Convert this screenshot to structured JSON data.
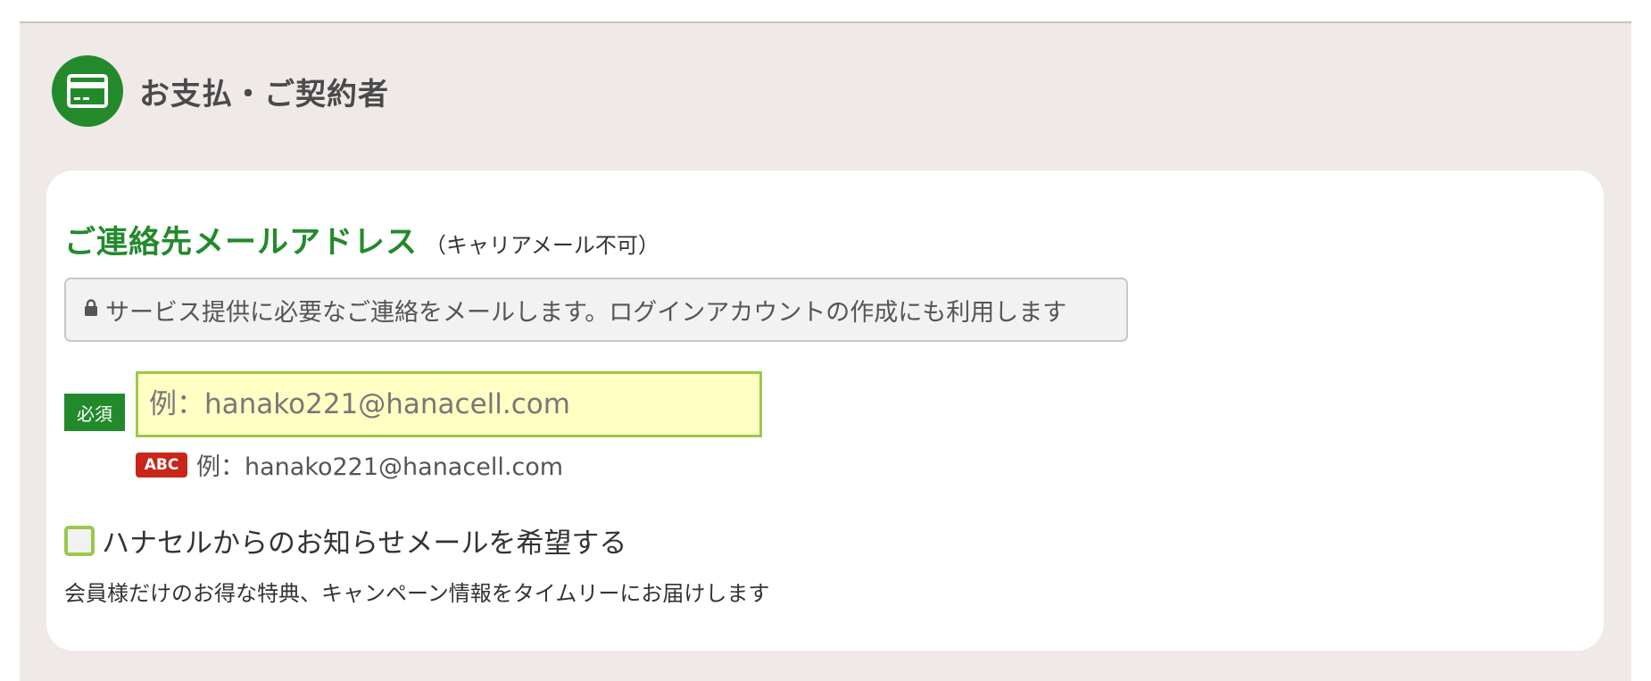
{
  "section": {
    "title": "お支払・ご契約者",
    "icon": "credit-card-icon",
    "accent": "#238a2c"
  },
  "email_field": {
    "title": "ご連絡先メールアドレス",
    "subtitle": "（キャリアメール不可）",
    "info": "サービス提供に必要なご連絡をメールします。ログインアカウントの作成にも利用します",
    "required_label": "必須",
    "placeholder": "例：hanako221@hanacell.com",
    "value": "",
    "hint_badge": "ABC",
    "hint_text": "例：hanako221@hanacell.com"
  },
  "newsletter": {
    "label": "ハナセルからのお知らせメールを希望する",
    "checked": false,
    "description": "会員様だけのお得な特典、キャンペーン情報をタイムリーにお届けします"
  }
}
